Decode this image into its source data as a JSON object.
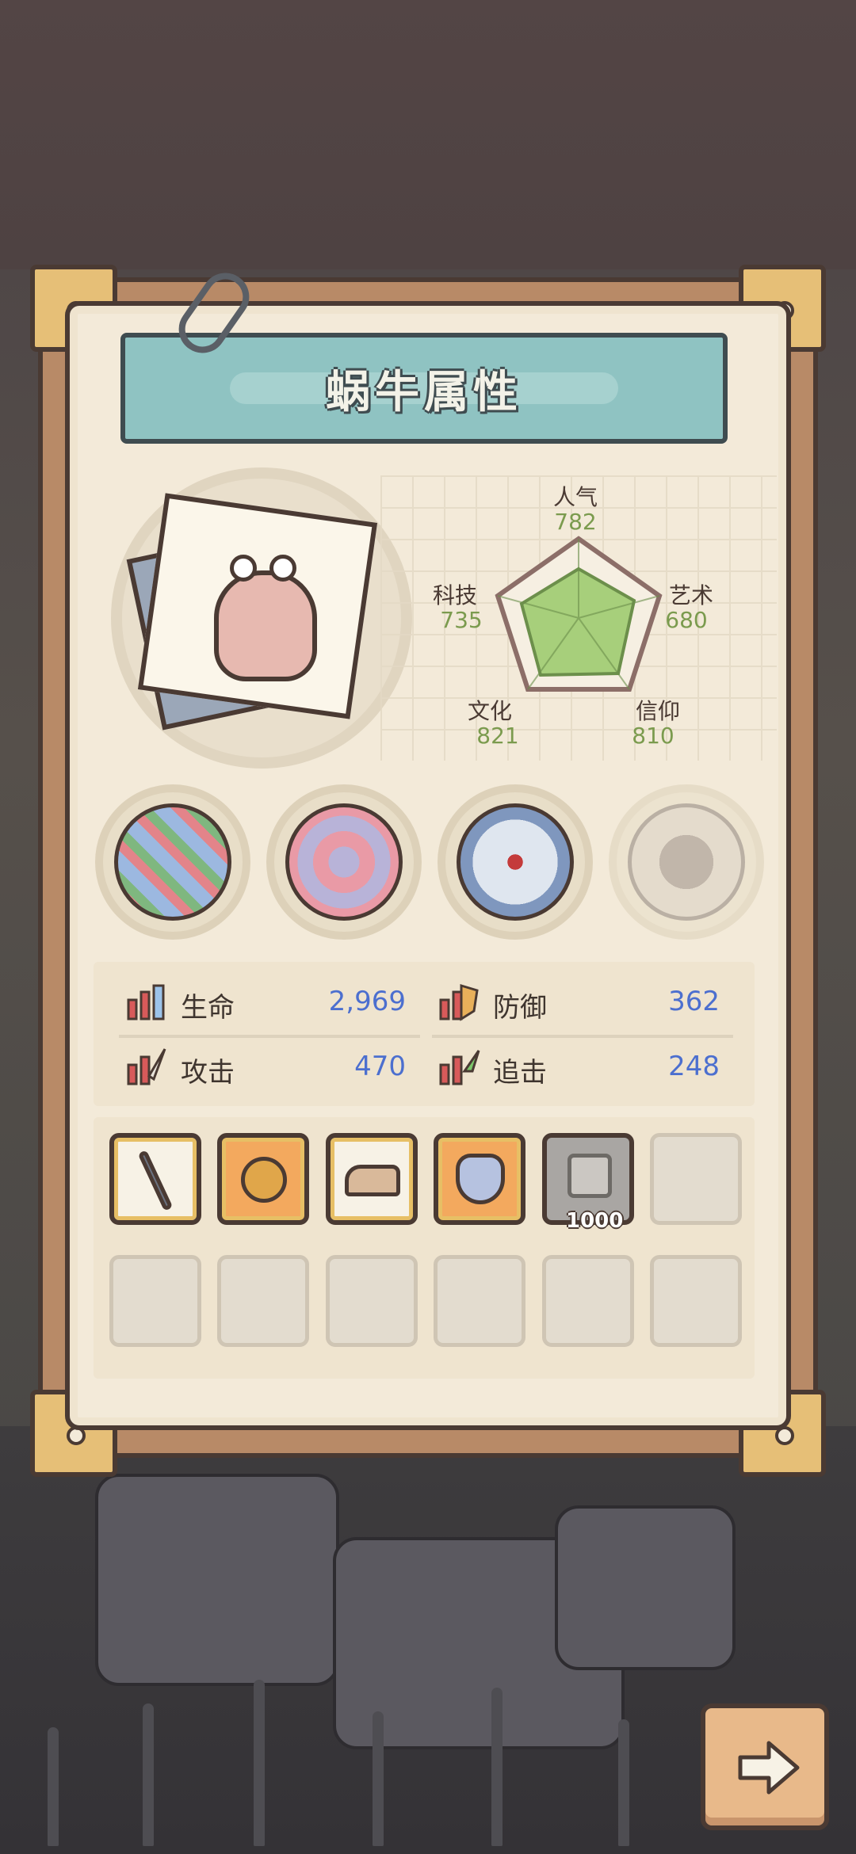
{
  "title": "蜗牛属性",
  "radar": {
    "popularity": {
      "label": "人气",
      "value": "782"
    },
    "art": {
      "label": "艺术",
      "value": "680"
    },
    "faith": {
      "label": "信仰",
      "value": "810"
    },
    "culture": {
      "label": "文化",
      "value": "821"
    },
    "tech": {
      "label": "科技",
      "value": "735"
    }
  },
  "stats": {
    "hp": {
      "label": "生命",
      "value": "2,969"
    },
    "defense": {
      "label": "防御",
      "value": "362"
    },
    "attack": {
      "label": "攻击",
      "value": "470"
    },
    "pursuit": {
      "label": "追击",
      "value": "248"
    }
  },
  "inventory": {
    "slot5_count": "1000"
  },
  "colors": {
    "panel": "#f3ead9",
    "banner": "#8fc3c2",
    "stat_value": "#4c6fcf",
    "radar_value": "#7b9b4e",
    "radar_fill": "#a7cf7b"
  }
}
